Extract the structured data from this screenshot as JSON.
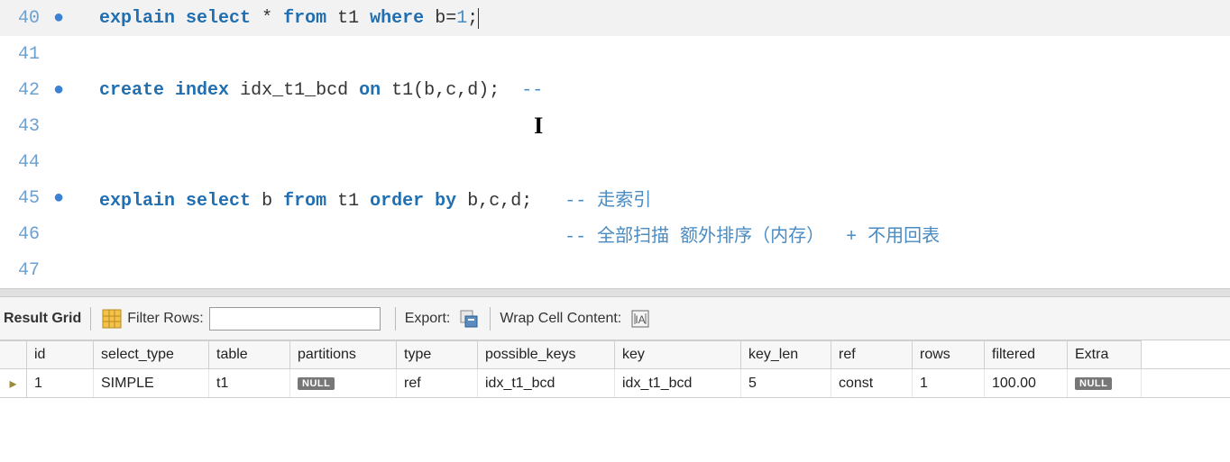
{
  "editor": {
    "lines": [
      {
        "num": "40",
        "bullet": true,
        "highlighted": true,
        "tokens": [
          [
            "kw",
            "explain"
          ],
          [
            "sp",
            " "
          ],
          [
            "kw",
            "select"
          ],
          [
            "sp",
            " "
          ],
          [
            "op",
            "*"
          ],
          [
            "sp",
            " "
          ],
          [
            "kw",
            "from"
          ],
          [
            "sp",
            " "
          ],
          [
            "ident",
            "t1"
          ],
          [
            "sp",
            " "
          ],
          [
            "kw",
            "where"
          ],
          [
            "sp",
            " "
          ],
          [
            "ident",
            "b"
          ],
          [
            "op",
            "="
          ],
          [
            "num",
            "1"
          ],
          [
            "op",
            ";"
          ]
        ],
        "cursorAtEnd": true
      },
      {
        "num": "41",
        "bullet": false,
        "tokens": []
      },
      {
        "num": "42",
        "bullet": true,
        "tokens": [
          [
            "kw",
            "create"
          ],
          [
            "sp",
            " "
          ],
          [
            "kw",
            "index"
          ],
          [
            "sp",
            " "
          ],
          [
            "ident",
            "idx_t1_bcd"
          ],
          [
            "sp",
            " "
          ],
          [
            "kw",
            "on"
          ],
          [
            "sp",
            " "
          ],
          [
            "ident",
            "t1"
          ],
          [
            "op",
            "("
          ],
          [
            "ident",
            "b"
          ],
          [
            "op",
            ","
          ],
          [
            "ident",
            "c"
          ],
          [
            "op",
            ","
          ],
          [
            "ident",
            "d"
          ],
          [
            "op",
            ")"
          ],
          [
            "op",
            ";"
          ],
          [
            "sp",
            "  "
          ],
          [
            "cmt",
            "--"
          ]
        ]
      },
      {
        "num": "43",
        "bullet": false,
        "tokens": [],
        "textCursor": true
      },
      {
        "num": "44",
        "bullet": false,
        "tokens": []
      },
      {
        "num": "45",
        "bullet": true,
        "tokens": [
          [
            "kw",
            "explain"
          ],
          [
            "sp",
            " "
          ],
          [
            "kw",
            "select"
          ],
          [
            "sp",
            " "
          ],
          [
            "ident",
            "b"
          ],
          [
            "sp",
            " "
          ],
          [
            "kw",
            "from"
          ],
          [
            "sp",
            " "
          ],
          [
            "ident",
            "t1"
          ],
          [
            "sp",
            " "
          ],
          [
            "kw",
            "order by"
          ],
          [
            "sp",
            " "
          ],
          [
            "ident",
            "b"
          ],
          [
            "op",
            ","
          ],
          [
            "ident",
            "c"
          ],
          [
            "op",
            ","
          ],
          [
            "ident",
            "d"
          ],
          [
            "op",
            ";"
          ],
          [
            "sp",
            "   "
          ],
          [
            "cmt",
            "-- 走索引"
          ]
        ]
      },
      {
        "num": "46",
        "bullet": false,
        "tokens": [
          [
            "sp",
            "                                           "
          ],
          [
            "cmt",
            "-- 全部扫描 额外排序（内存）  + 不用回表"
          ]
        ]
      },
      {
        "num": "47",
        "bullet": false,
        "tokens": []
      }
    ]
  },
  "toolbar": {
    "result_grid": "Result Grid",
    "filter_rows": "Filter Rows:",
    "export": "Export:",
    "wrap": "Wrap Cell Content:"
  },
  "grid": {
    "columns": [
      "id",
      "select_type",
      "table",
      "partitions",
      "type",
      "possible_keys",
      "key",
      "key_len",
      "ref",
      "rows",
      "filtered",
      "Extra"
    ],
    "row": {
      "id": "1",
      "select_type": "SIMPLE",
      "table": "t1",
      "partitions": null,
      "type": "ref",
      "possible_keys": "idx_t1_bcd",
      "key": "idx_t1_bcd",
      "key_len": "5",
      "ref": "const",
      "rows": "1",
      "filtered": "100.00",
      "Extra": null
    },
    "null_label": "NULL"
  }
}
